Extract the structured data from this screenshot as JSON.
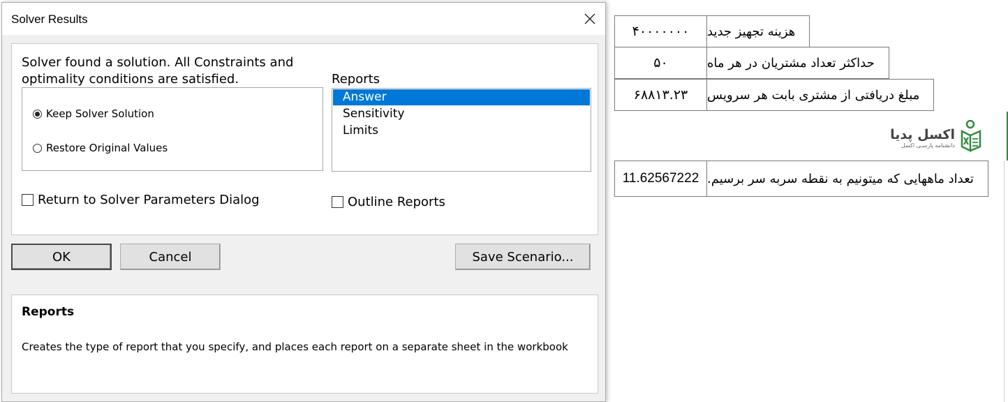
{
  "sheet": {
    "rows": [
      {
        "value": "۴۰۰۰۰۰۰۰",
        "label": "هزینه تجهیز جدید"
      },
      {
        "value": "۵۰",
        "label": "حداکثر تعداد مشتریان در هر ماه"
      },
      {
        "value": "۶۸۸۱۳.۲۳",
        "label": "مبلغ دریافتی از مشتری بابت هر سرویس"
      },
      {
        "value": "11.62567222",
        "label": "تعداد ماههایی که میتونیم به نقطه سربه سر برسیم."
      }
    ],
    "logo": {
      "title": "اکسل پدیا",
      "subtitle": "دانشنامه پارسـی اکسل"
    }
  },
  "dialog": {
    "title": "Solver Results",
    "message_line1": "Solver found a solution.  All Constraints and",
    "message_line2": "optimality conditions are satisfied.",
    "radio_keep": "Keep Solver Solution",
    "radio_restore": "Restore Original Values",
    "reports_label": "Reports",
    "reports": [
      "Answer",
      "Sensitivity",
      "Limits"
    ],
    "selected_report": "Answer",
    "check_return": "Return to Solver Parameters Dialog",
    "check_outline": "Outline Reports",
    "btn_ok": "OK",
    "btn_cancel": "Cancel",
    "btn_save": "Save Scenario...",
    "desc_title": "Reports",
    "desc_text": "Creates the type of report that you specify, and places each report on a separate sheet in the workbook"
  },
  "colors": {
    "selection": "#0078d7",
    "logo_green": "#2e8b3e"
  }
}
